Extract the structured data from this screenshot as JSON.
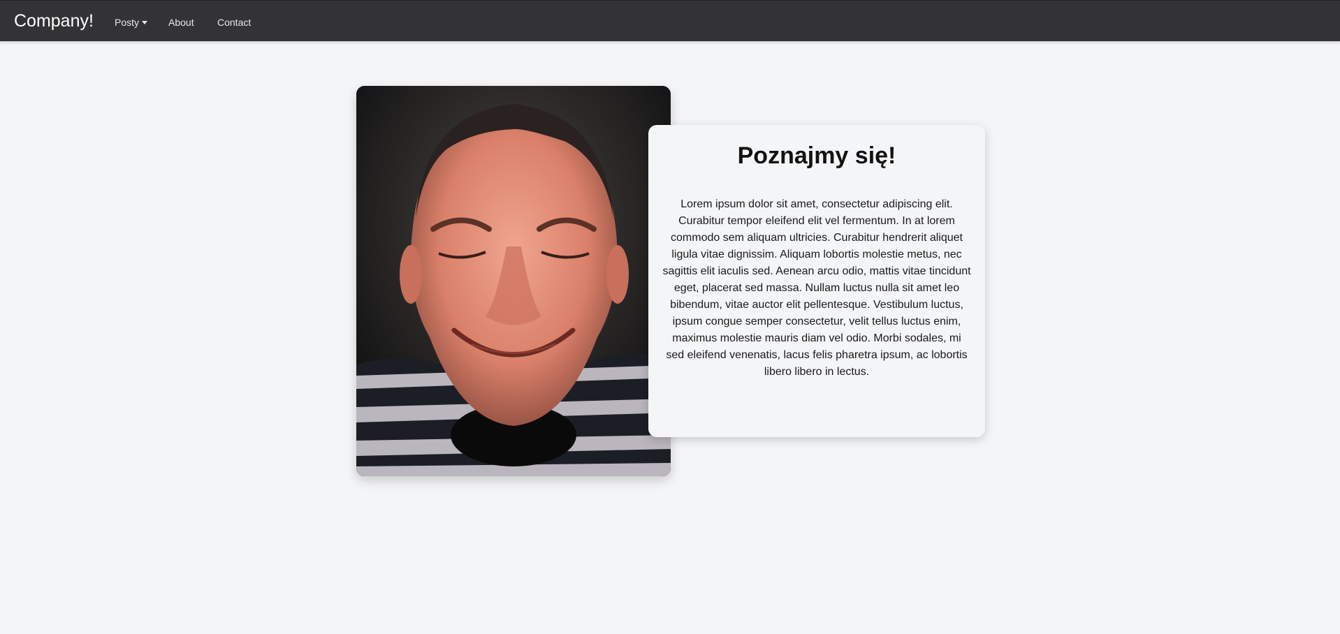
{
  "navbar": {
    "brand": "Company!",
    "items": [
      {
        "label": "Posty",
        "has_dropdown": true
      },
      {
        "label": "About"
      },
      {
        "label": "Contact"
      }
    ]
  },
  "about": {
    "heading": "Poznajmy się!",
    "body": "Lorem ipsum dolor sit amet, consectetur adipiscing elit. Curabitur tempor eleifend elit vel fermentum. In at lorem commodo sem aliquam ultricies. Curabitur hendrerit aliquet ligula vitae dignissim. Aliquam lobortis molestie metus, nec sagittis elit iaculis sed. Aenean arcu odio, mattis vitae tincidunt eget, placerat sed massa. Nullam luctus nulla sit amet leo bibendum, vitae auctor elit pellentesque. Vestibulum luctus, ipsum congue semper consectetur, velit tellus luctus enim, maximus molestie mauris diam vel odio. Morbi sodales, mi sed eleifend venenatis, lacus felis pharetra ipsum, ac lobortis libero libero in lectus."
  },
  "colors": {
    "navbar_bg": "#333335",
    "page_bg": "#f4f5f7",
    "heading": "#121212"
  }
}
